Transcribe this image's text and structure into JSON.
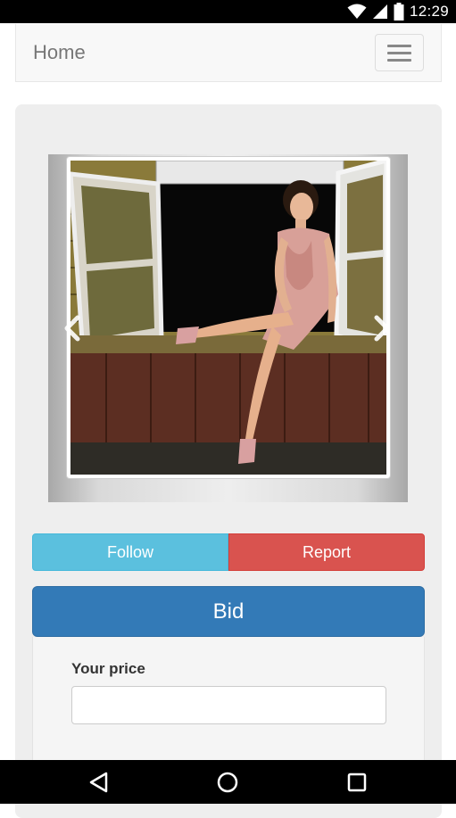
{
  "status_bar": {
    "time": "12:29",
    "icons": [
      "wifi-icon",
      "signal-icon",
      "battery-icon"
    ]
  },
  "navbar": {
    "brand": "Home",
    "toggle_icon": "hamburger-menu-icon"
  },
  "carousel": {
    "image_alt": "Woman in pink dress sitting on window sill",
    "prev_icon": "chevron-left-icon",
    "next_icon": "chevron-right-icon"
  },
  "actions": {
    "follow_label": "Follow",
    "report_label": "Report",
    "bid_label": "Bid"
  },
  "bid_form": {
    "price_label": "Your price",
    "price_value": ""
  },
  "system_nav": {
    "icons": [
      "back-icon",
      "home-icon",
      "recents-icon"
    ]
  },
  "colors": {
    "follow": "#5bc0de",
    "report": "#d9534f",
    "bid": "#337ab7"
  }
}
